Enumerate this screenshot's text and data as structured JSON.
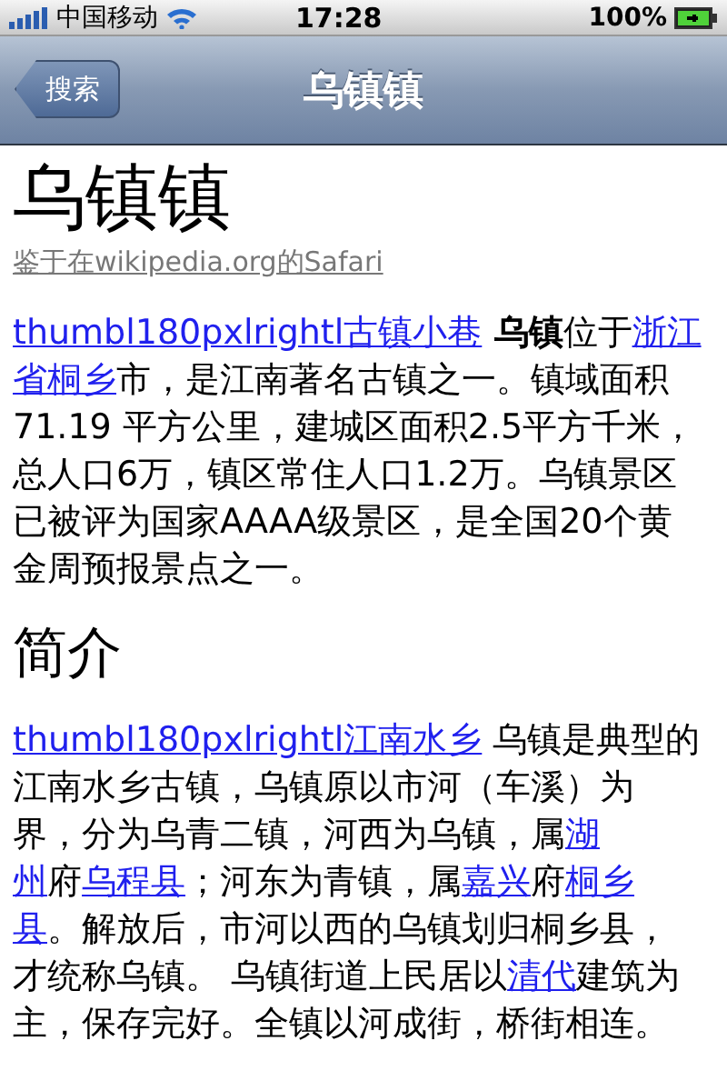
{
  "status_bar": {
    "carrier": "中国移动",
    "time": "17:28",
    "battery": "100%"
  },
  "nav_bar": {
    "back_button": "搜索",
    "title": "乌镇镇"
  },
  "article": {
    "title": "乌镇镇",
    "source": "鉴于在wikipedia.org的Safari",
    "sections": [
      {
        "lines": [
          [
            {
              "kind": "link",
              "text": "thumbl180pxlrightl古镇小巷"
            },
            {
              "kind": "bold",
              "text": " 乌镇"
            },
            {
              "kind": "text",
              "text": "位于"
            },
            {
              "kind": "link",
              "text": "浙江"
            }
          ],
          [
            {
              "kind": "link",
              "text": "省桐乡"
            },
            {
              "kind": "text",
              "text": "市，是江南著名古镇之一。镇域面积"
            }
          ],
          [
            {
              "kind": "text",
              "text": "71.19 平方公里，建城区面积2.5平方千米，"
            }
          ],
          [
            {
              "kind": "text",
              "text": "总人口6万，镇区常住人口1.2万。乌镇景区"
            }
          ],
          [
            {
              "kind": "text",
              "text": "已被评为国家AAAA级景区，是全国20个黄"
            }
          ],
          [
            {
              "kind": "text",
              "text": "金周预报景点之一。"
            }
          ]
        ]
      },
      {
        "heading": "简介",
        "lines": [
          [
            {
              "kind": "link",
              "text": "thumbl180pxlrightl江南水乡"
            },
            {
              "kind": "text",
              "text": " 乌镇是典型的"
            }
          ],
          [
            {
              "kind": "text",
              "text": "江南水乡古镇，乌镇原以市河（车溪）为"
            }
          ],
          [
            {
              "kind": "text",
              "text": "界，分为乌青二镇，河西为乌镇，属"
            },
            {
              "kind": "link",
              "text": "湖"
            }
          ],
          [
            {
              "kind": "link",
              "text": "州"
            },
            {
              "kind": "text",
              "text": "府"
            },
            {
              "kind": "link",
              "text": "乌程县"
            },
            {
              "kind": "text",
              "text": "；河东为青镇，属"
            },
            {
              "kind": "link",
              "text": "嘉兴"
            },
            {
              "kind": "text",
              "text": "府"
            },
            {
              "kind": "link",
              "text": "桐乡"
            }
          ],
          [
            {
              "kind": "link",
              "text": "县"
            },
            {
              "kind": "text",
              "text": "。解放后，市河以西的乌镇划归桐乡县，"
            }
          ],
          [
            {
              "kind": "text",
              "text": "才统称乌镇。 乌镇街道上民居以"
            },
            {
              "kind": "link",
              "text": "清代"
            },
            {
              "kind": "text",
              "text": "建筑为"
            }
          ],
          [
            {
              "kind": "text",
              "text": "主，保存完好。全镇以河成街，桥街相连。"
            }
          ]
        ]
      }
    ]
  }
}
